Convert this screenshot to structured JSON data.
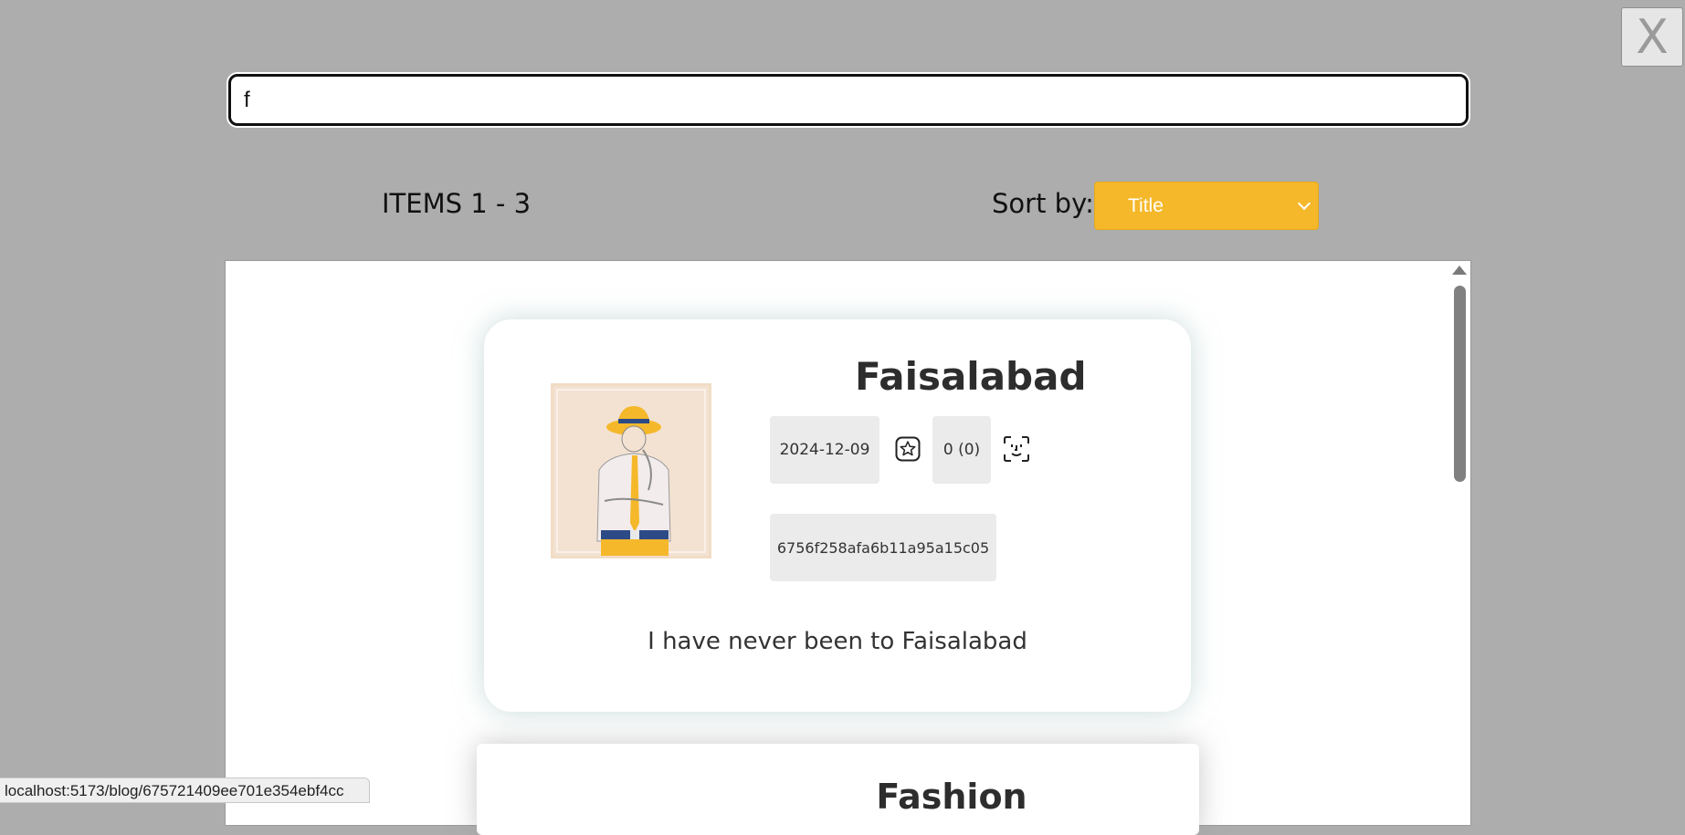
{
  "close_label": "X",
  "search": {
    "value": "f"
  },
  "list_header": {
    "items_count": "ITEMS 1 - 3",
    "sort_label": "Sort by:",
    "sort_value": "Title"
  },
  "cards": [
    {
      "title": "Faisalabad",
      "date": "2024-12-09",
      "rating": "0 (0)",
      "id": "6756f258afa6b11a95a15c05",
      "description": "I have never been to Faisalabad"
    },
    {
      "title": "Fashion"
    }
  ],
  "status_bar": {
    "url": "localhost:5173/blog/675721409ee701e354ebf4cc"
  },
  "colors": {
    "page_bg": "#adadad",
    "sort_accent": "#f5b82a",
    "chip_bg": "#ebebeb"
  },
  "icons": {
    "favorite": "star-icon",
    "face": "face-scan-icon",
    "sort": "chevron-down-icon"
  }
}
